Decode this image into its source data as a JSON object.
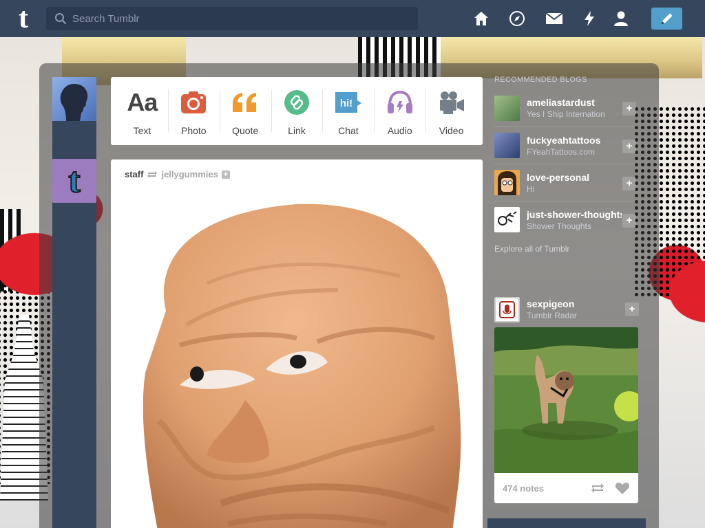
{
  "search": {
    "placeholder": "Search Tumblr"
  },
  "nav": {
    "icons": [
      "home-icon",
      "explore-icon",
      "inbox-icon",
      "activity-icon",
      "account-icon"
    ],
    "compose_icon": "pencil-icon"
  },
  "post_types": [
    {
      "label": "Text",
      "icon": "Aa",
      "color": "#444444"
    },
    {
      "label": "Photo",
      "icon": "camera-icon",
      "color": "#d95e40"
    },
    {
      "label": "Quote",
      "icon": "quote-icon",
      "color": "#f2992e"
    },
    {
      "label": "Link",
      "icon": "link-icon",
      "color": "#56bc8a"
    },
    {
      "label": "Chat",
      "icon": "hi!",
      "color": "#529ecc"
    },
    {
      "label": "Audio",
      "icon": "headphones-icon",
      "color": "#a77dc2"
    },
    {
      "label": "Video",
      "icon": "video-camera-icon",
      "color": "#748089"
    }
  ],
  "post": {
    "author": "staff",
    "reblogged_from": "jellygummies"
  },
  "sidebar": {
    "title": "Recommended Blogs",
    "items": [
      {
        "name": "ameliastardust",
        "subtitle": "Yes I Ship Internation",
        "avatar_color": "#6a8c5a"
      },
      {
        "name": "fuckyeahtattoos",
        "subtitle": "FYeahTattoos.com",
        "avatar_color": "#4a5d8c"
      },
      {
        "name": "love-personal",
        "subtitle": "Hi",
        "avatar_color": "#e0a44a"
      },
      {
        "name": "just-shower-thoughts",
        "subtitle": "Shower Thoughts",
        "avatar_color": "#ffffff"
      }
    ],
    "explore_label": "Explore all of Tumblr",
    "radar": {
      "name": "sexpigeon",
      "subtitle": "Tumblr Radar",
      "notes": "474 notes"
    }
  }
}
